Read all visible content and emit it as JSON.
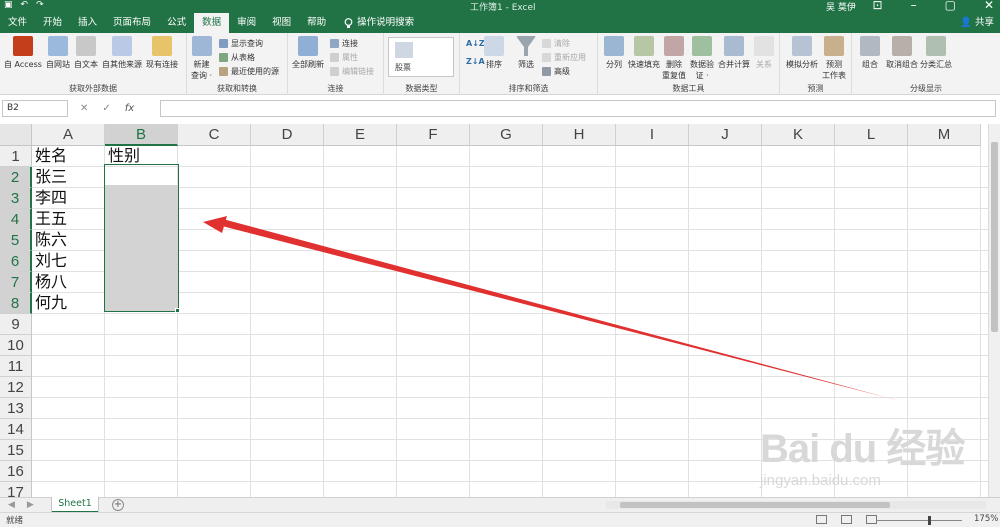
{
  "app": {
    "title": "工作簿1 - Excel",
    "user": "吴 莫伊",
    "share": "共享",
    "colors": {
      "brand": "#217346",
      "annotation": "#e03030"
    }
  },
  "qat": {
    "save_icon": "save-icon",
    "undo_icon": "undo-icon",
    "redo_icon": "redo-icon"
  },
  "tabs": [
    {
      "label": "文件"
    },
    {
      "label": "开始"
    },
    {
      "label": "插入"
    },
    {
      "label": "页面布局"
    },
    {
      "label": "公式"
    },
    {
      "label": "数据",
      "active": true
    },
    {
      "label": "审阅"
    },
    {
      "label": "视图"
    },
    {
      "label": "帮助"
    }
  ],
  "tellme": "操作说明搜索",
  "ribbon": {
    "groups": {
      "external": "获取外部数据",
      "transform": "获取和转换",
      "connections": "连接",
      "datatypes": "数据类型",
      "sortfilter": "排序和筛选",
      "datatools": "数据工具",
      "forecast": "预测",
      "outline": "分级显示"
    },
    "external": {
      "access": "自 Access",
      "web": "自网站",
      "text": "自文本",
      "other": "自其他来源",
      "existing": "现有连接"
    },
    "transform": {
      "newquery_1": "新建",
      "newquery_2": "查询 ·",
      "show": "显示查询",
      "fromtable": "从表格",
      "recent": "最近使用的源"
    },
    "connections": {
      "refresh": "全部刷新",
      "conn": "连接",
      "props": "属性",
      "editlinks": "编辑链接"
    },
    "datatypes": {
      "stocks": "股票"
    },
    "sortfilter": {
      "sort": "排序",
      "filter": "筛选",
      "clear": "清除",
      "reapply": "重新应用",
      "advanced": "高级"
    },
    "datatools": {
      "split": "分列",
      "flash": "快速填充",
      "remove_1": "删除",
      "remove_2": "重复值",
      "validate_1": "数据验",
      "validate_2": "证 ·",
      "consolidate": "合并计算",
      "relations": "关系"
    },
    "forecast": {
      "whatif": "模拟分析",
      "sheet_1": "预测",
      "sheet_2": "工作表"
    },
    "outline": {
      "group": "组合",
      "ungroup": "取消组合",
      "subtotal": "分类汇总"
    }
  },
  "formula_bar": {
    "namebox": "B2",
    "fx": "fx",
    "value": ""
  },
  "columns": [
    "A",
    "B",
    "C",
    "D",
    "E",
    "F",
    "G",
    "H",
    "I",
    "J",
    "K",
    "L",
    "M"
  ],
  "rows": [
    "1",
    "2",
    "3",
    "4",
    "5",
    "6",
    "7",
    "8",
    "9",
    "10",
    "11",
    "12",
    "13",
    "14",
    "15",
    "16",
    "17"
  ],
  "cells": {
    "A1": "姓名",
    "B1": "性别",
    "A2": "张三",
    "A3": "李四",
    "A4": "王五",
    "A5": "陈六",
    "A6": "刘七",
    "A7": "杨八",
    "A8": "何九"
  },
  "selection": {
    "active": "B2",
    "range": "B2:B8"
  },
  "sheets": [
    {
      "name": "Sheet1",
      "active": true
    }
  ],
  "status": {
    "text": "就绪",
    "zoom": "175%"
  },
  "watermark": {
    "brand": "Bai du 经验",
    "url": "jingyan.baidu.com"
  }
}
